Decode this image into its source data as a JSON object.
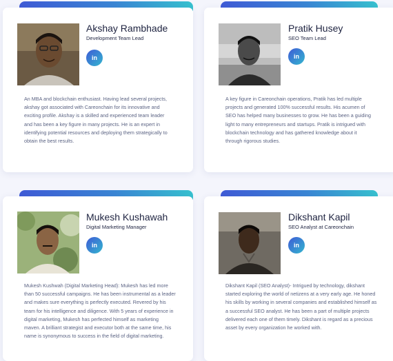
{
  "members": [
    {
      "name": "Akshay Rambhade",
      "role": "Development Team Lead",
      "linkedin_label": "in",
      "bio": "An MBA and blockchain enthusiast. Having lead several projects, akshay got associated with Careonchain for its innovative and exciting profile. Akshay is a skilled and experienced team leader and has been a key figure in many projects. He is an expert in identifying potential resources and deploying them strategically to obtain the best results."
    },
    {
      "name": "Pratik Husey",
      "role": "SEO Team Lead",
      "linkedin_label": "in",
      "bio": "A key figure in Careonchain operations, Pratik has led multiple projects and generated 100% successful results. His acumen of SEO has helped many businesses to grow. He has been a guiding light to many entrepreneurs and startups. Pratik is intrigued with blockchain technology and has gathered knowledge about it through rigorous studies."
    },
    {
      "name": "Mukesh Kushawah",
      "role": "Digital Marketing Manager",
      "linkedin_label": "in",
      "bio": "Mukesh Kushwah (Digital Marketing Head): Mukesh has led more than 50 successful campaigns. He has been instrumental as a leader and makes sure everything is perfectly executed. Revered by his team for his intelligence and diligence. With 5 years of experience in digital marketing, Mukesh has perfected himself as marketing maven. A brilliant strategist and executor both at the same time, his name is synonymous to success in the field of digital marketing."
    },
    {
      "name": "Dikshant Kapil",
      "role": "SEO Analyst at Careonchain",
      "linkedin_label": "in",
      "bio": "Dikshant Kapil (SEO Analyst)- Intrigued by technology, dikshant started exploring the world of netizens at a very early age. He honed his skills by working in several companies and established himself as a successful SEO analyst. He has been a part of multiple projects delivered each one of them timely. Dikshant is regard as a precious asset by every organization he worked with."
    }
  ],
  "colors": {
    "accent_start": "#3f5bd6",
    "accent_end": "#37c1cf",
    "page_bg": "#f4f5fc",
    "text_dark": "#1e2340",
    "text_muted": "#5b6383"
  },
  "icons": {
    "linkedin": "linkedin-icon"
  }
}
